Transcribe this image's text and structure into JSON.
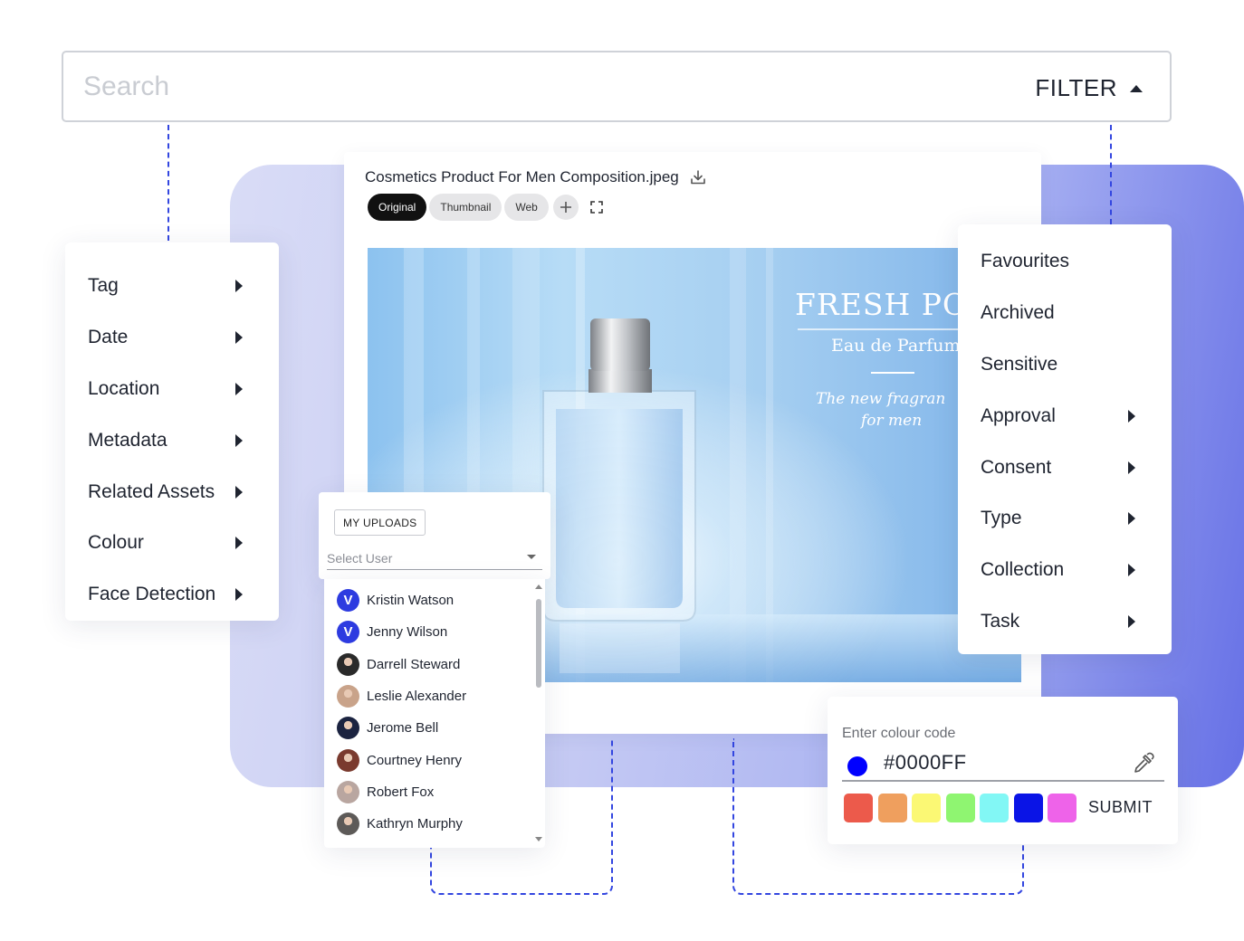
{
  "search": {
    "placeholder": "Search",
    "filter_label": "FILTER"
  },
  "left_menu": {
    "items": [
      {
        "label": "Tag",
        "has_submenu": true
      },
      {
        "label": "Date",
        "has_submenu": true
      },
      {
        "label": "Location",
        "has_submenu": true
      },
      {
        "label": "Metadata",
        "has_submenu": true
      },
      {
        "label": "Related Assets",
        "has_submenu": true
      },
      {
        "label": "Colour",
        "has_submenu": true
      },
      {
        "label": "Face Detection",
        "has_submenu": true
      }
    ]
  },
  "viewer": {
    "file_name": "Cosmetics Product For Men Composition.jpeg",
    "tabs": [
      {
        "label": "Original",
        "active": true
      },
      {
        "label": "Thumbnail",
        "active": false
      },
      {
        "label": "Web",
        "active": false
      }
    ],
    "image_text": {
      "headline": "FRESH POW",
      "subline": "Eau de Parfum",
      "tagline_1": "The new fragran",
      "tagline_2": "for men"
    }
  },
  "right_menu": {
    "items": [
      {
        "label": "Favourites",
        "has_submenu": false
      },
      {
        "label": "Archived",
        "has_submenu": false
      },
      {
        "label": "Sensitive",
        "has_submenu": false
      },
      {
        "label": "Approval",
        "has_submenu": true
      },
      {
        "label": "Consent",
        "has_submenu": true
      },
      {
        "label": "Type",
        "has_submenu": true
      },
      {
        "label": "Collection",
        "has_submenu": true
      },
      {
        "label": "Task",
        "has_submenu": true
      }
    ]
  },
  "user_picker": {
    "my_uploads_label": "MY UPLOADS",
    "select_placeholder": "Select User",
    "users": [
      {
        "name": "Kristin Watson",
        "avatar": "brand",
        "color": "#2d3be0"
      },
      {
        "name": "Jenny Wilson",
        "avatar": "brand",
        "color": "#2d3be0"
      },
      {
        "name": "Darrell Steward",
        "avatar": "photo",
        "color": "#2a2a2a"
      },
      {
        "name": "Leslie Alexander",
        "avatar": "photo",
        "color": "#c9a38a"
      },
      {
        "name": "Jerome Bell",
        "avatar": "photo",
        "color": "#1b2340"
      },
      {
        "name": "Courtney Henry",
        "avatar": "photo",
        "color": "#7a3a2e"
      },
      {
        "name": "Robert Fox",
        "avatar": "photo",
        "color": "#b9a6a0"
      },
      {
        "name": "Kathryn Murphy",
        "avatar": "photo",
        "color": "#5d5a58"
      }
    ],
    "brand_letter": "V"
  },
  "colour_picker": {
    "label": "Enter colour code",
    "value": "#0000FF",
    "submit_label": "SUBMIT",
    "swatches": [
      "#ec5a4b",
      "#ef9f5e",
      "#fbf874",
      "#8ff571",
      "#82f7f5",
      "#0a14e6",
      "#ee63e9"
    ]
  }
}
